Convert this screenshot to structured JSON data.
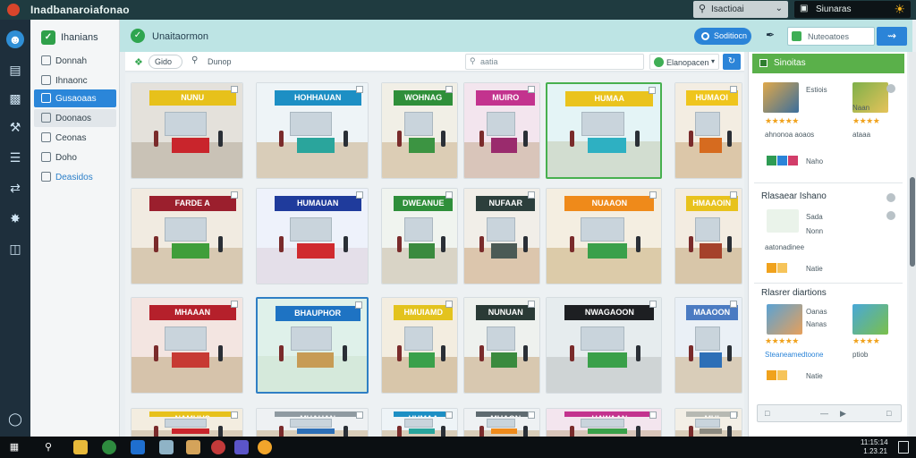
{
  "app": {
    "title": "Inadbanaroiafonao"
  },
  "titlebar": {
    "search_label": "Isactioai",
    "account_label": "Siunaras"
  },
  "rail": {
    "icons": [
      "avatar-icon",
      "stack-icon",
      "layers-icon",
      "wrench-icon",
      "sliders-icon",
      "flow-icon",
      "puzzle-icon",
      "storage-icon",
      "help-icon"
    ]
  },
  "nav": {
    "brand": "Ihanians",
    "items": [
      {
        "label": "Donnah",
        "state": "normal"
      },
      {
        "label": "Ihnaonc",
        "state": "normal"
      },
      {
        "label": "Gusaoaas",
        "state": "selected"
      },
      {
        "label": "Doonaos",
        "state": "hover"
      },
      {
        "label": "Ceonas",
        "state": "normal"
      },
      {
        "label": "Doho",
        "state": "normal"
      },
      {
        "label": "Deasidos",
        "state": "link"
      }
    ]
  },
  "header": {
    "title": "Unaitaormon",
    "pill_label": "Soditiocn",
    "search_placeholder": "Nuteoatoes",
    "go_icon": "arrow-icon"
  },
  "filter": {
    "chip_label": "Gido",
    "search_label": "Dunop",
    "box_placeholder": "aatia",
    "select_value": "Elanopacen",
    "refresh_icon": "refresh-icon"
  },
  "cards": [
    {
      "sign": "NUNU",
      "sign_color": "#e7c11b",
      "wall": "#e4e1db",
      "floor": "#c9c2b6",
      "accent": "#c9252c"
    },
    {
      "sign": "HOHHAUAN",
      "sign_color": "#1d8fc4",
      "wall": "#eef4f7",
      "floor": "#d9cdb9",
      "accent": "#2aa59c"
    },
    {
      "sign": "WOHNAG",
      "sign_color": "#2f8f3a",
      "wall": "#f1efe6",
      "floor": "#dccdb5",
      "accent": "#3c9442"
    },
    {
      "sign": "MUIRO",
      "sign_color": "#c3338e",
      "wall": "#f3e5ee",
      "floor": "#d9c5ba",
      "accent": "#9a2b6d"
    },
    {
      "sign": "HUMAA",
      "sign_color": "#eac31d",
      "wall": "#e4f4f6",
      "floor": "#d2ddd0",
      "accent": "#2eb0c2"
    },
    {
      "sign": "HUMAOI",
      "sign_color": "#efc51d",
      "wall": "#f3ede2",
      "floor": "#dcc7a9",
      "accent": "#d66b1f"
    },
    {
      "sign": "FARDE A",
      "sign_color": "#9b1f2d",
      "wall": "#f1ebe1",
      "floor": "#d8c9b2",
      "accent": "#3f9e3a"
    },
    {
      "sign": "HUMAUAN",
      "sign_color": "#1f3b9c",
      "wall": "#eef2fb",
      "floor": "#e4dfe9",
      "accent": "#d02a2f"
    },
    {
      "sign": "DWEANUE",
      "sign_color": "#2f8f3a",
      "wall": "#f0f4ef",
      "floor": "#d9d4c6",
      "accent": "#3a8a3e"
    },
    {
      "sign": "NUFAAR",
      "sign_color": "#2c3f3c",
      "wall": "#f1eee8",
      "floor": "#dcc6ad",
      "accent": "#4b5a55"
    },
    {
      "sign": "NUAAON",
      "sign_color": "#ef8a1a",
      "wall": "#f4eee1",
      "floor": "#dccba9",
      "accent": "#3aa04a"
    },
    {
      "sign": "HMAAOIN",
      "sign_color": "#e8c21c",
      "wall": "#f3ece1",
      "floor": "#d8c6a9",
      "accent": "#a5422b"
    },
    {
      "sign": "MHAAAN",
      "sign_color": "#b5202b",
      "wall": "#f3e5e1",
      "floor": "#d6c3ab",
      "accent": "#c73a33"
    },
    {
      "sign": "BHAUPHOR",
      "sign_color": "#1e73c3",
      "wall": "#dff1ea",
      "floor": "#d5e9db",
      "accent": "#c79b55"
    },
    {
      "sign": "HMUIAMD",
      "sign_color": "#e3c31e",
      "wall": "#f3ede0",
      "floor": "#d8c6aa",
      "accent": "#3aa04a"
    },
    {
      "sign": "NUNUAN",
      "sign_color": "#2a3a36",
      "wall": "#eef1ee",
      "floor": "#d8c8b0",
      "accent": "#3a8a3e"
    },
    {
      "sign": "NWAGAOON",
      "sign_color": "#1d1f22",
      "wall": "#e6ecee",
      "floor": "#cfd4d5",
      "accent": "#3aa04a"
    },
    {
      "sign": "MAAOON",
      "sign_color": "#4b7bc2",
      "wall": "#eaf0f6",
      "floor": "#d9cdb9",
      "accent": "#2d6fb7"
    },
    {
      "sign": "NAMUHS",
      "sign_color": "#e7c11b",
      "wall": "#f3ede0",
      "floor": "#d9cdb9",
      "accent": "#c9252c"
    },
    {
      "sign": "MUAUAN",
      "sign_color": "#8f9aa1",
      "wall": "#eef1f3",
      "floor": "#d9cdb9",
      "accent": "#2d6fb7"
    },
    {
      "sign": "HUMAA",
      "sign_color": "#1d8fc4",
      "wall": "#eef4f7",
      "floor": "#d9cdb9",
      "accent": "#2aa59c"
    },
    {
      "sign": "MUAON",
      "sign_color": "#5e6a70",
      "wall": "#eef1f3",
      "floor": "#d9cdb9",
      "accent": "#ef8a1a"
    },
    {
      "sign": "HAWAAN",
      "sign_color": "#c3338e",
      "wall": "#f3e5ee",
      "floor": "#d9c5ba",
      "accent": "#3aa04a"
    },
    {
      "sign": "MUI",
      "sign_color": "#b7b9b3",
      "wall": "#f3efe6",
      "floor": "#d9cdb9",
      "accent": "#8c8a80"
    }
  ],
  "panel": {
    "header": "Sinoitas",
    "entry1": {
      "name": "Estiois",
      "name2": "Naan",
      "stars1": "★★★★★",
      "stars2": "★★★★",
      "meta": "ahnonoa aoaos",
      "meta2": "ataaa",
      "tag": "Naho"
    },
    "section1": "Rlasaear Ishano",
    "entry2": {
      "line1": "Sada",
      "line2": "Nonn",
      "meta": "aatonadinee",
      "tag": "Natie"
    },
    "section2": "Rlasrer diartions",
    "entry3": {
      "name": "Oanas",
      "name2": "Nanas",
      "stars1": "★★★★★",
      "stars2": "★★★★",
      "meta": "Steaneamedtoone",
      "meta2": "ptiob",
      "tag": "Natie"
    }
  },
  "taskbar": {
    "time": "11:15:14",
    "date": "1.23.21"
  }
}
